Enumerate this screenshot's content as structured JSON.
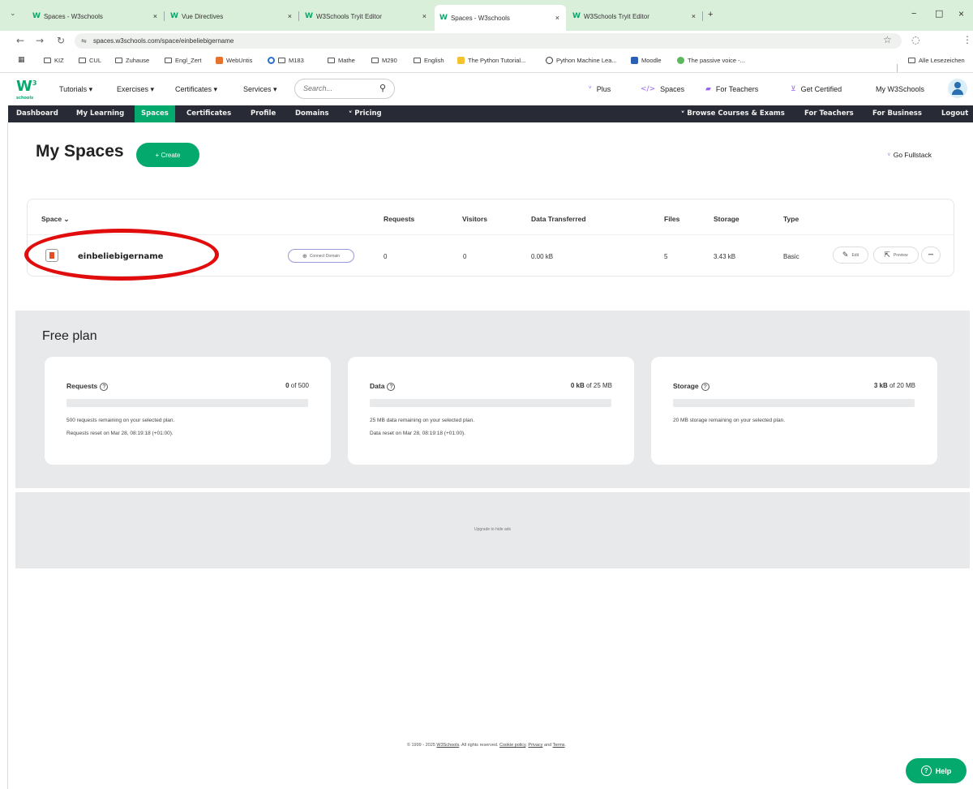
{
  "browser": {
    "tabs": [
      {
        "label": "Spaces - W3schools",
        "active": false
      },
      {
        "label": "Vue Directives",
        "active": false
      },
      {
        "label": "W3Schools Tryit Editor",
        "active": false
      },
      {
        "label": "Spaces - W3schools",
        "active": true
      },
      {
        "label": "W3Schools Tryit Editor",
        "active": false
      }
    ],
    "tab_close": "×",
    "new_tab": "+",
    "window_controls": {
      "minimize": "−",
      "maximize": "□",
      "close": "×"
    },
    "url": "spaces.w3schools.com/space/einbeliebigername",
    "bookmarks": [
      {
        "label": "KIZ",
        "icon": "folder-icon"
      },
      {
        "label": "CUL",
        "icon": "folder-icon"
      },
      {
        "label": "Zuhause",
        "icon": "folder-icon"
      },
      {
        "label": "Engl_Zert",
        "icon": "folder-icon"
      },
      {
        "label": "WebUntis",
        "icon": "webuntis-icon"
      },
      {
        "label": "M183",
        "icon": "folder-icon"
      },
      {
        "label": "Mathe",
        "icon": "folder-icon"
      },
      {
        "label": "M290",
        "icon": "folder-icon"
      },
      {
        "label": "English",
        "icon": "folder-icon"
      },
      {
        "label": "The Python Tutorial...",
        "icon": "python-icon"
      },
      {
        "label": "Python Machine Lea...",
        "icon": "ml-icon"
      },
      {
        "label": "Moodle",
        "icon": "moodle-icon"
      },
      {
        "label": "The passive voice -...",
        "icon": "passive-icon"
      }
    ],
    "all_bookmarks": "Alle Lesezeichen"
  },
  "header": {
    "logo": "W",
    "logo_sup": "3",
    "logo_sub": "schools",
    "menus": [
      "Tutorials ▾",
      "Exercises ▾",
      "Certificates ▾",
      "Services ▾"
    ],
    "search_placeholder": "Search...",
    "links": {
      "plus": "Plus",
      "spaces": "Spaces",
      "teachers": "For Teachers",
      "certified": "Get Certified",
      "my": "My W3Schools"
    }
  },
  "subnav": {
    "left": [
      "Dashboard",
      "My Learning",
      "Spaces",
      "Certificates",
      "Profile",
      "Domains",
      "Pricing"
    ],
    "right": [
      "Browse Courses & Exams",
      "For Teachers",
      "For Business",
      "Logout"
    ]
  },
  "page": {
    "title": "My Spaces",
    "create": "+  Create",
    "go_fullstack": "Go Fullstack"
  },
  "table": {
    "headers": {
      "space": "Space ⌄",
      "requests": "Requests",
      "visitors": "Visitors",
      "data": "Data Transferred",
      "files": "Files",
      "storage": "Storage",
      "type": "Type"
    },
    "row": {
      "name": "einbeliebigername",
      "connect": "Connect Domain",
      "requests": "0",
      "visitors": "0",
      "data": "0.00 kB",
      "files": "5",
      "storage": "3.43 kB",
      "type": "Basic",
      "edit": "Edit",
      "preview": "Preview",
      "more": "•••"
    },
    "highlight_color": "#e10d0d"
  },
  "plan": {
    "title": "Free plan",
    "cards": [
      {
        "label": "Requests",
        "value_used": "0",
        "value_rest": " of 500",
        "fill": 0.0,
        "line1": "500 requests remaining on your selected plan.",
        "line2": "Requests reset on Mar 28, 08:19:18 (+01:00)."
      },
      {
        "label": "Data",
        "value_used": "0 kB",
        "value_rest": " of 25 MB",
        "fill": 0.0,
        "line1": "25 MB data remaining on your selected plan.",
        "line2": "Data reset on Mar 28, 08:19:18 (+01:00)."
      },
      {
        "label": "Storage",
        "value_used": "3 kB",
        "value_rest": " of 20 MB",
        "fill": 0.0,
        "line1": "20 MB storage remaining on your selected plan.",
        "line2": ""
      }
    ]
  },
  "ad": {
    "text": "Upgrade to hide ads"
  },
  "footer": {
    "prefix": "© 1999 - 2025 ",
    "brand": "W3Schools",
    "middle": ". All rights reserved. ",
    "cookie": "Cookie policy",
    "comma": ", ",
    "privacy": "Privacy",
    "and": " and ",
    "terms": "Terms",
    "end": "."
  },
  "help": {
    "label": "Help",
    "icon": "?"
  },
  "colors": {
    "brand_green": "#04AA6D",
    "nav_dark": "#282A35",
    "accent_purple": "#9763f6"
  }
}
